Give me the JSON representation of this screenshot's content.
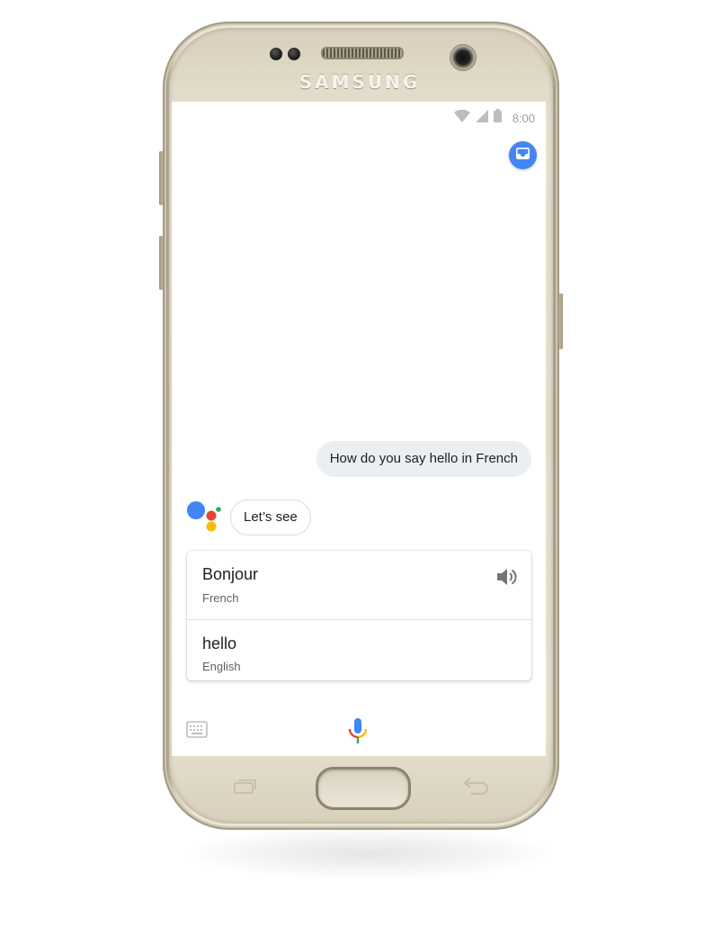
{
  "device": {
    "brand": "SAMSUNG",
    "body_color": "#e7e1d1"
  },
  "status_bar": {
    "time": "8:00",
    "icons": [
      "wifi-icon",
      "signal-icon",
      "battery-icon"
    ]
  },
  "header": {
    "inbox_icon": "inbox-icon",
    "accent_color": "#4285f4"
  },
  "conversation": {
    "user_query": "How do you say hello in French",
    "assistant_reply": "Let’s see",
    "assistant_logo_colors": [
      "#4285f4",
      "#ea4335",
      "#fbbc05",
      "#34a853"
    ]
  },
  "translation_card": {
    "source": {
      "word": "Bonjour",
      "language": "French",
      "action_icon": "speaker-icon"
    },
    "target": {
      "word": "hello",
      "language": "English"
    }
  },
  "input_bar": {
    "keyboard_icon": "keyboard-icon",
    "mic_icon": "microphone-icon"
  },
  "nav_keys": [
    "recents-icon",
    "home-button",
    "back-icon"
  ]
}
